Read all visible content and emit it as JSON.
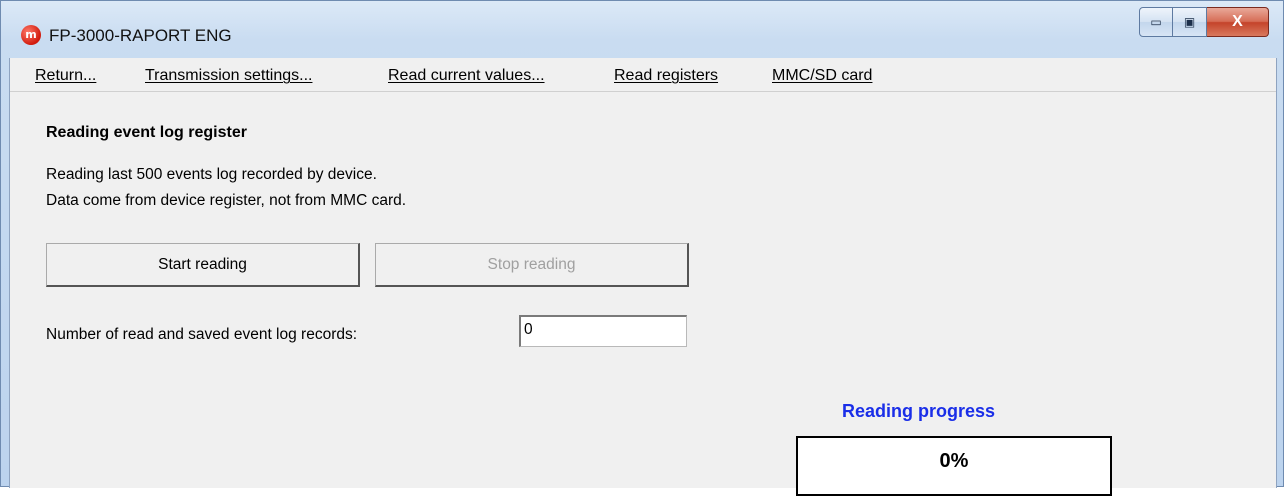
{
  "window": {
    "title": "FP-3000-RAPORT ENG",
    "app_icon_letter": "m",
    "controls": {
      "minimize": "▭",
      "maximize": "▣",
      "close": "X"
    }
  },
  "menu": {
    "items": [
      "Return...",
      "Transmission settings...",
      "Read current values...",
      "Read registers",
      "MMC/SD card"
    ]
  },
  "content": {
    "section_title": "Reading event log register",
    "description_line1": "Reading last 500 events log recorded by device.",
    "description_line2": "Data come from device register, not from MMC card.",
    "start_button": "Start reading",
    "stop_button": "Stop reading",
    "records_label": "Number of read and saved event log records:",
    "records_value": "0",
    "progress_title": "Reading progress",
    "progress_text": "0%",
    "progress_fraction": 0
  },
  "colors": {
    "progress_title": "#1a2ee8",
    "close_button": "#c4432a",
    "client_bg": "#f0f0f0"
  }
}
